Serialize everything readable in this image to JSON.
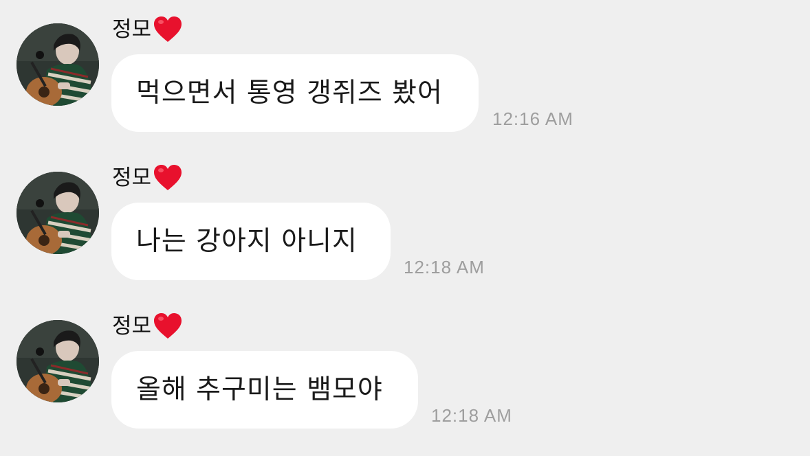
{
  "messages": [
    {
      "sender": "정모",
      "sender_icon": "heart-icon",
      "text": "먹으면서 통영 갱쥐즈 봤어",
      "time": "12:16 AM"
    },
    {
      "sender": "정모",
      "sender_icon": "heart-icon",
      "text": "나는 강아지 아니지",
      "time": "12:18 AM"
    },
    {
      "sender": "정모",
      "sender_icon": "heart-icon",
      "text": "올해 추구미는 뱀모야",
      "time": "12:18 AM"
    }
  ],
  "colors": {
    "background": "#efefef",
    "bubble": "#ffffff",
    "heart": "#e8112d",
    "timestamp": "#9e9e9e"
  }
}
